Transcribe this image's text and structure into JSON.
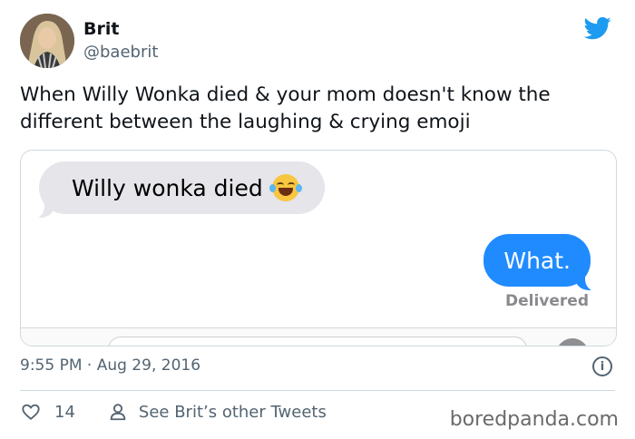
{
  "tweet": {
    "author_name": "Brit",
    "author_handle": "@baebrit",
    "text": "When Willy Wonka died & your mom doesn't know the different between the laughing & crying emoji",
    "timestamp": "9:55 PM · Aug 29, 2016",
    "like_count": "14",
    "see_more_label": "See Brit’s other Tweets"
  },
  "media": {
    "incoming_message": "Willy wonka died",
    "incoming_emoji": "face-with-tears-of-joy",
    "outgoing_message": "What.",
    "delivered_label": "Delivered"
  },
  "watermark": "boredpanda.com",
  "colors": {
    "twitter_blue": "#1d9bf0",
    "imessage_blue": "#1f8bff",
    "incoming_gray": "#e5e5ea",
    "secondary_text": "#536471"
  },
  "icons": {
    "brand": "twitter-bird-icon",
    "info": "info-icon",
    "like": "heart-icon",
    "profile": "person-icon"
  }
}
